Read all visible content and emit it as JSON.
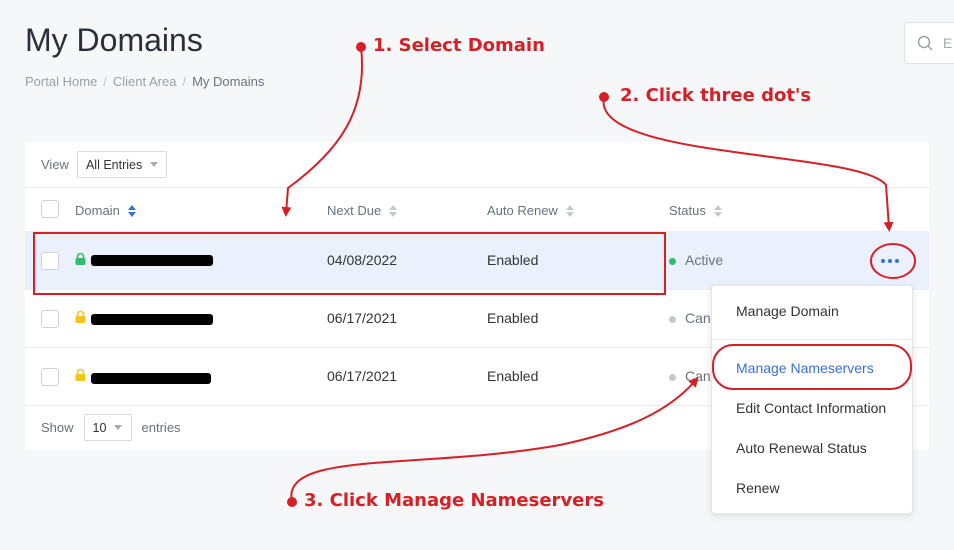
{
  "page": {
    "title": "My Domains",
    "breadcrumb": [
      "Portal Home",
      "Client Area",
      "My Domains"
    ],
    "search_placeholder": "E"
  },
  "table": {
    "view_label": "View",
    "view_select": "All Entries",
    "columns": [
      "Domain",
      "Next Due",
      "Auto Renew",
      "Status"
    ],
    "rows": [
      {
        "next_due": "04/08/2022",
        "auto_renew": "Enabled",
        "status": "Active",
        "status_color": "#2ebd6b",
        "lock_color": "#2ebd6b"
      },
      {
        "next_due": "06/17/2021",
        "auto_renew": "Enabled",
        "status": "Canc",
        "status_color": "#c4c8cd",
        "lock_color": "#f5c518"
      },
      {
        "next_due": "06/17/2021",
        "auto_renew": "Enabled",
        "status": "Canc",
        "status_color": "#c4c8cd",
        "lock_color": "#f5c518"
      }
    ],
    "show_label": "Show",
    "show_value": "10",
    "entries_label": "entries"
  },
  "menu": {
    "items": [
      "Manage Domain",
      "Manage Nameservers",
      "Edit Contact Information",
      "Auto Renewal Status",
      "Renew"
    ]
  },
  "annotations": {
    "step1": "1. Select Domain",
    "step2": "2. Click three dot's",
    "step3": "3. Click Manage Nameservers",
    "color": "#d71f27"
  },
  "colors": {
    "accent": "#3b6fd8",
    "selected_row": "#eaf1fc"
  }
}
